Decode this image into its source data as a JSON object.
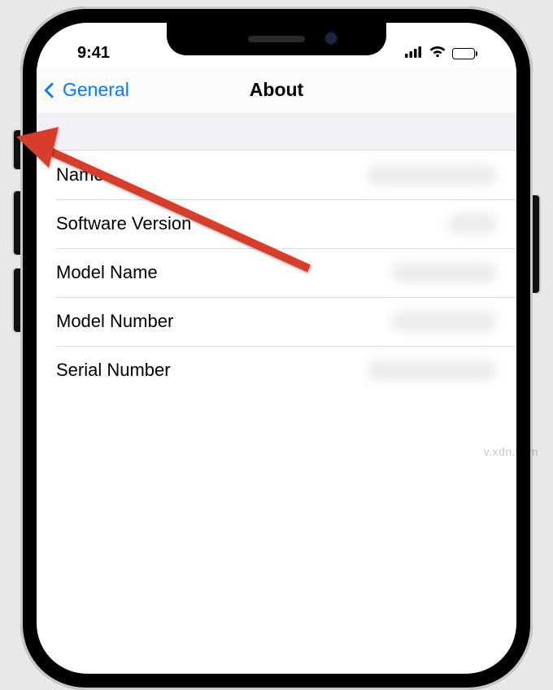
{
  "status_bar": {
    "time": "9:41"
  },
  "nav": {
    "back_label": "General",
    "title": "About"
  },
  "rows": [
    {
      "label": "Name"
    },
    {
      "label": "Software Version"
    },
    {
      "label": "Model Name"
    },
    {
      "label": "Model Number"
    },
    {
      "label": "Serial Number"
    }
  ],
  "watermark": "v.xdn.com",
  "colors": {
    "ios_blue": "#007aff",
    "arrow_red": "#d63c2a"
  }
}
